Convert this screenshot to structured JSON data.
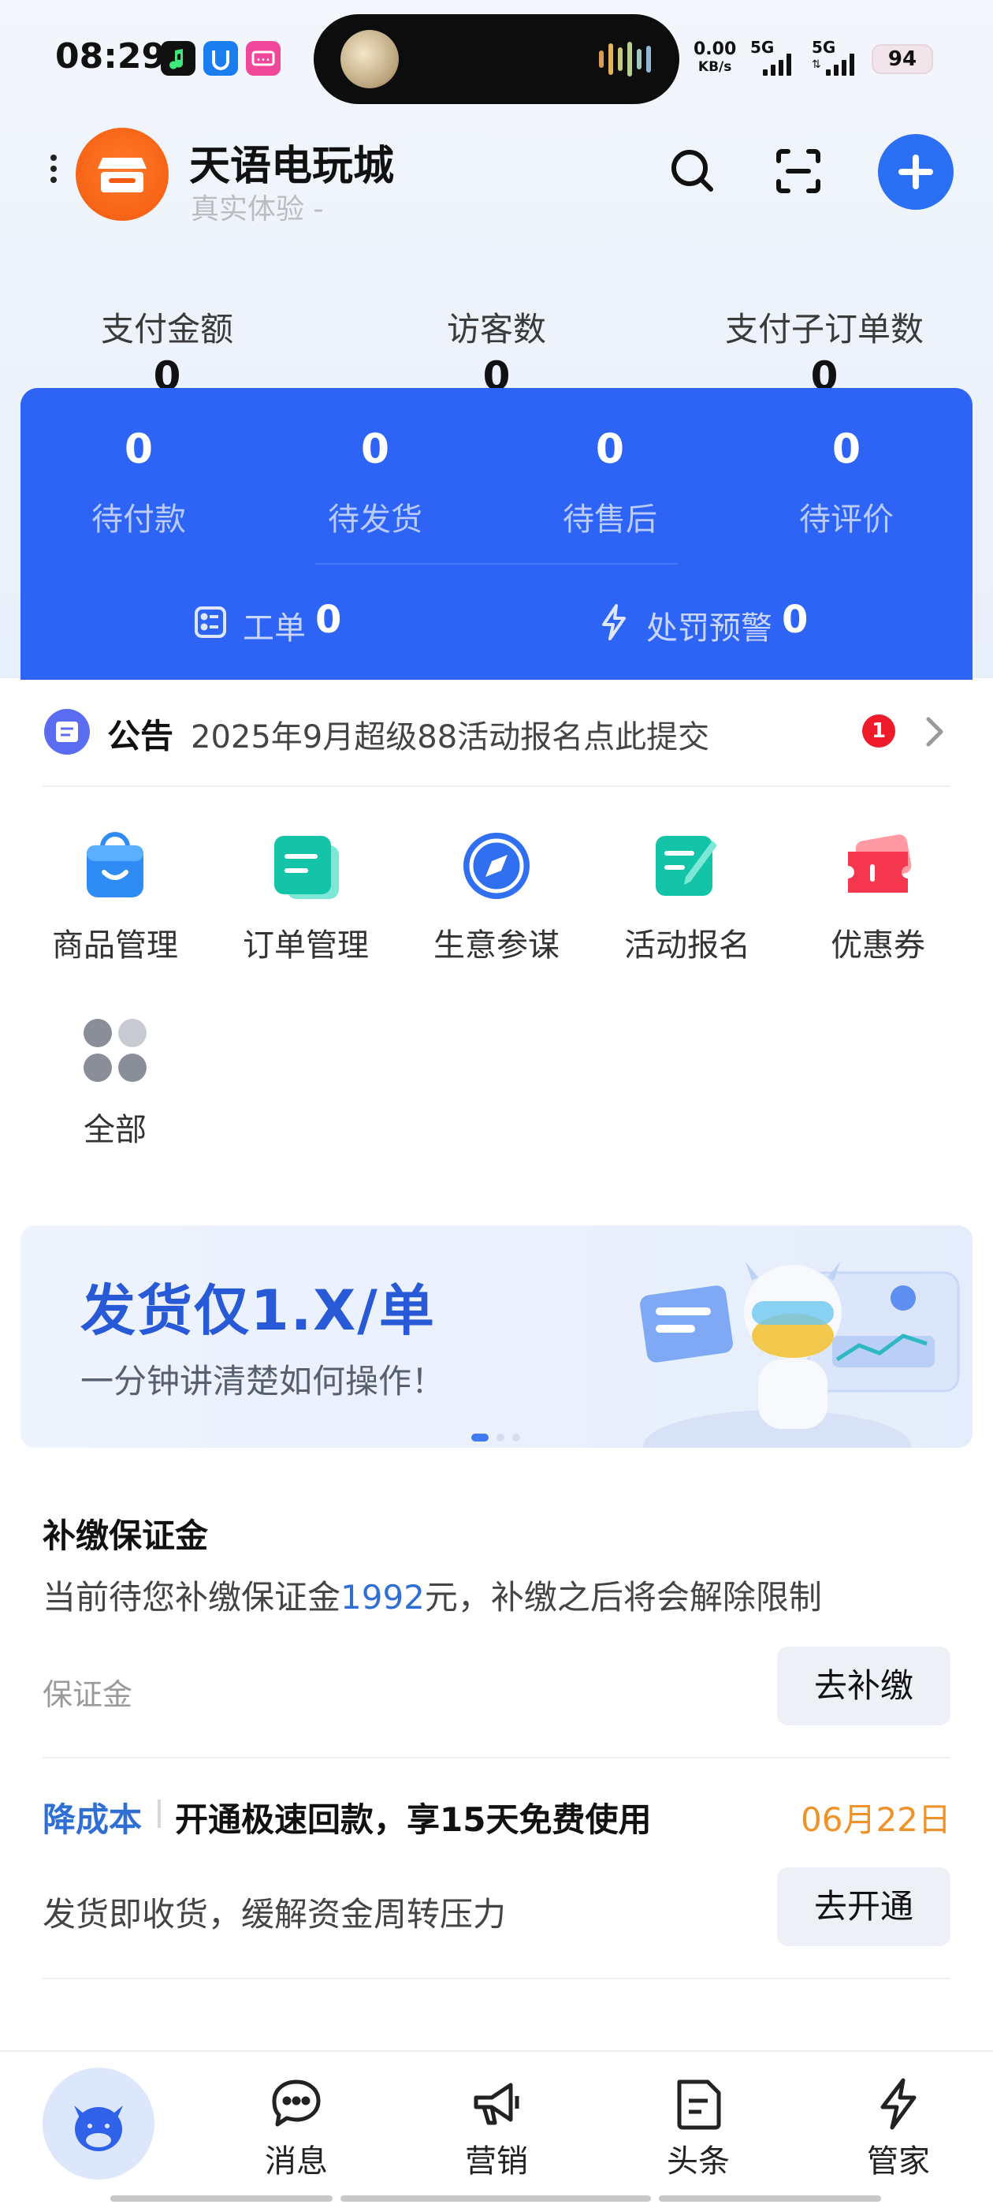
{
  "status_bar": {
    "time": "08:29",
    "net_speed_value": "0.00",
    "net_speed_unit": "KB/s",
    "signal1_label": "5G",
    "signal2_label": "5G",
    "battery": "94",
    "app_icon_colors": [
      "#111111",
      "#1a7df0",
      "#f0479a"
    ]
  },
  "header": {
    "shop_name": "天语电玩城",
    "shop_subtitle": "真实体验 -",
    "logo_color": "#f45a0e",
    "accent_color": "#2b6ff5"
  },
  "stats": [
    {
      "label": "支付金额",
      "value": "0"
    },
    {
      "label": "访客数",
      "value": "0"
    },
    {
      "label": "支付子订单数",
      "value": "0"
    }
  ],
  "orders": {
    "card_color": "#2e64f6",
    "items": [
      {
        "value": "0",
        "label": "待付款"
      },
      {
        "value": "0",
        "label": "待发货"
      },
      {
        "value": "0",
        "label": "待售后"
      },
      {
        "value": "0",
        "label": "待评价"
      }
    ],
    "work_order_label": "工单",
    "work_order_value": "0",
    "penalty_label": "处罚预警",
    "penalty_value": "0"
  },
  "notice": {
    "title": "公告",
    "text": "2025年9月超级88活动报名点此提交",
    "badge": "1"
  },
  "tools": [
    {
      "label": "商品管理",
      "icon": "shopping-bag-icon"
    },
    {
      "label": "订单管理",
      "icon": "order-icon"
    },
    {
      "label": "生意参谋",
      "icon": "compass-icon"
    },
    {
      "label": "活动报名",
      "icon": "signup-icon"
    },
    {
      "label": "优惠券",
      "icon": "coupon-icon"
    },
    {
      "label": "全部",
      "icon": "grid-icon"
    }
  ],
  "banner": {
    "title": "发货仅1.X/单",
    "subtitle": "一分钟讲清楚如何操作！"
  },
  "deposit": {
    "title": "补缴保证金",
    "desc_before": "当前待您补缴保证金",
    "amount": "1992",
    "desc_after": "元，补缴之后将会解除限制",
    "label": "保证金",
    "button": "去补缴"
  },
  "promo": {
    "tag": "降成本",
    "title": "开通极速回款，享15天免费使用",
    "date": "06月22日",
    "desc": "发货即收货，缓解资金周转压力",
    "button": "去开通"
  },
  "bottom_nav": [
    {
      "label": "消息",
      "icon": "message-icon"
    },
    {
      "label": "营销",
      "icon": "megaphone-icon"
    },
    {
      "label": "头条",
      "icon": "news-icon"
    },
    {
      "label": "管家",
      "icon": "lightning-icon"
    }
  ]
}
